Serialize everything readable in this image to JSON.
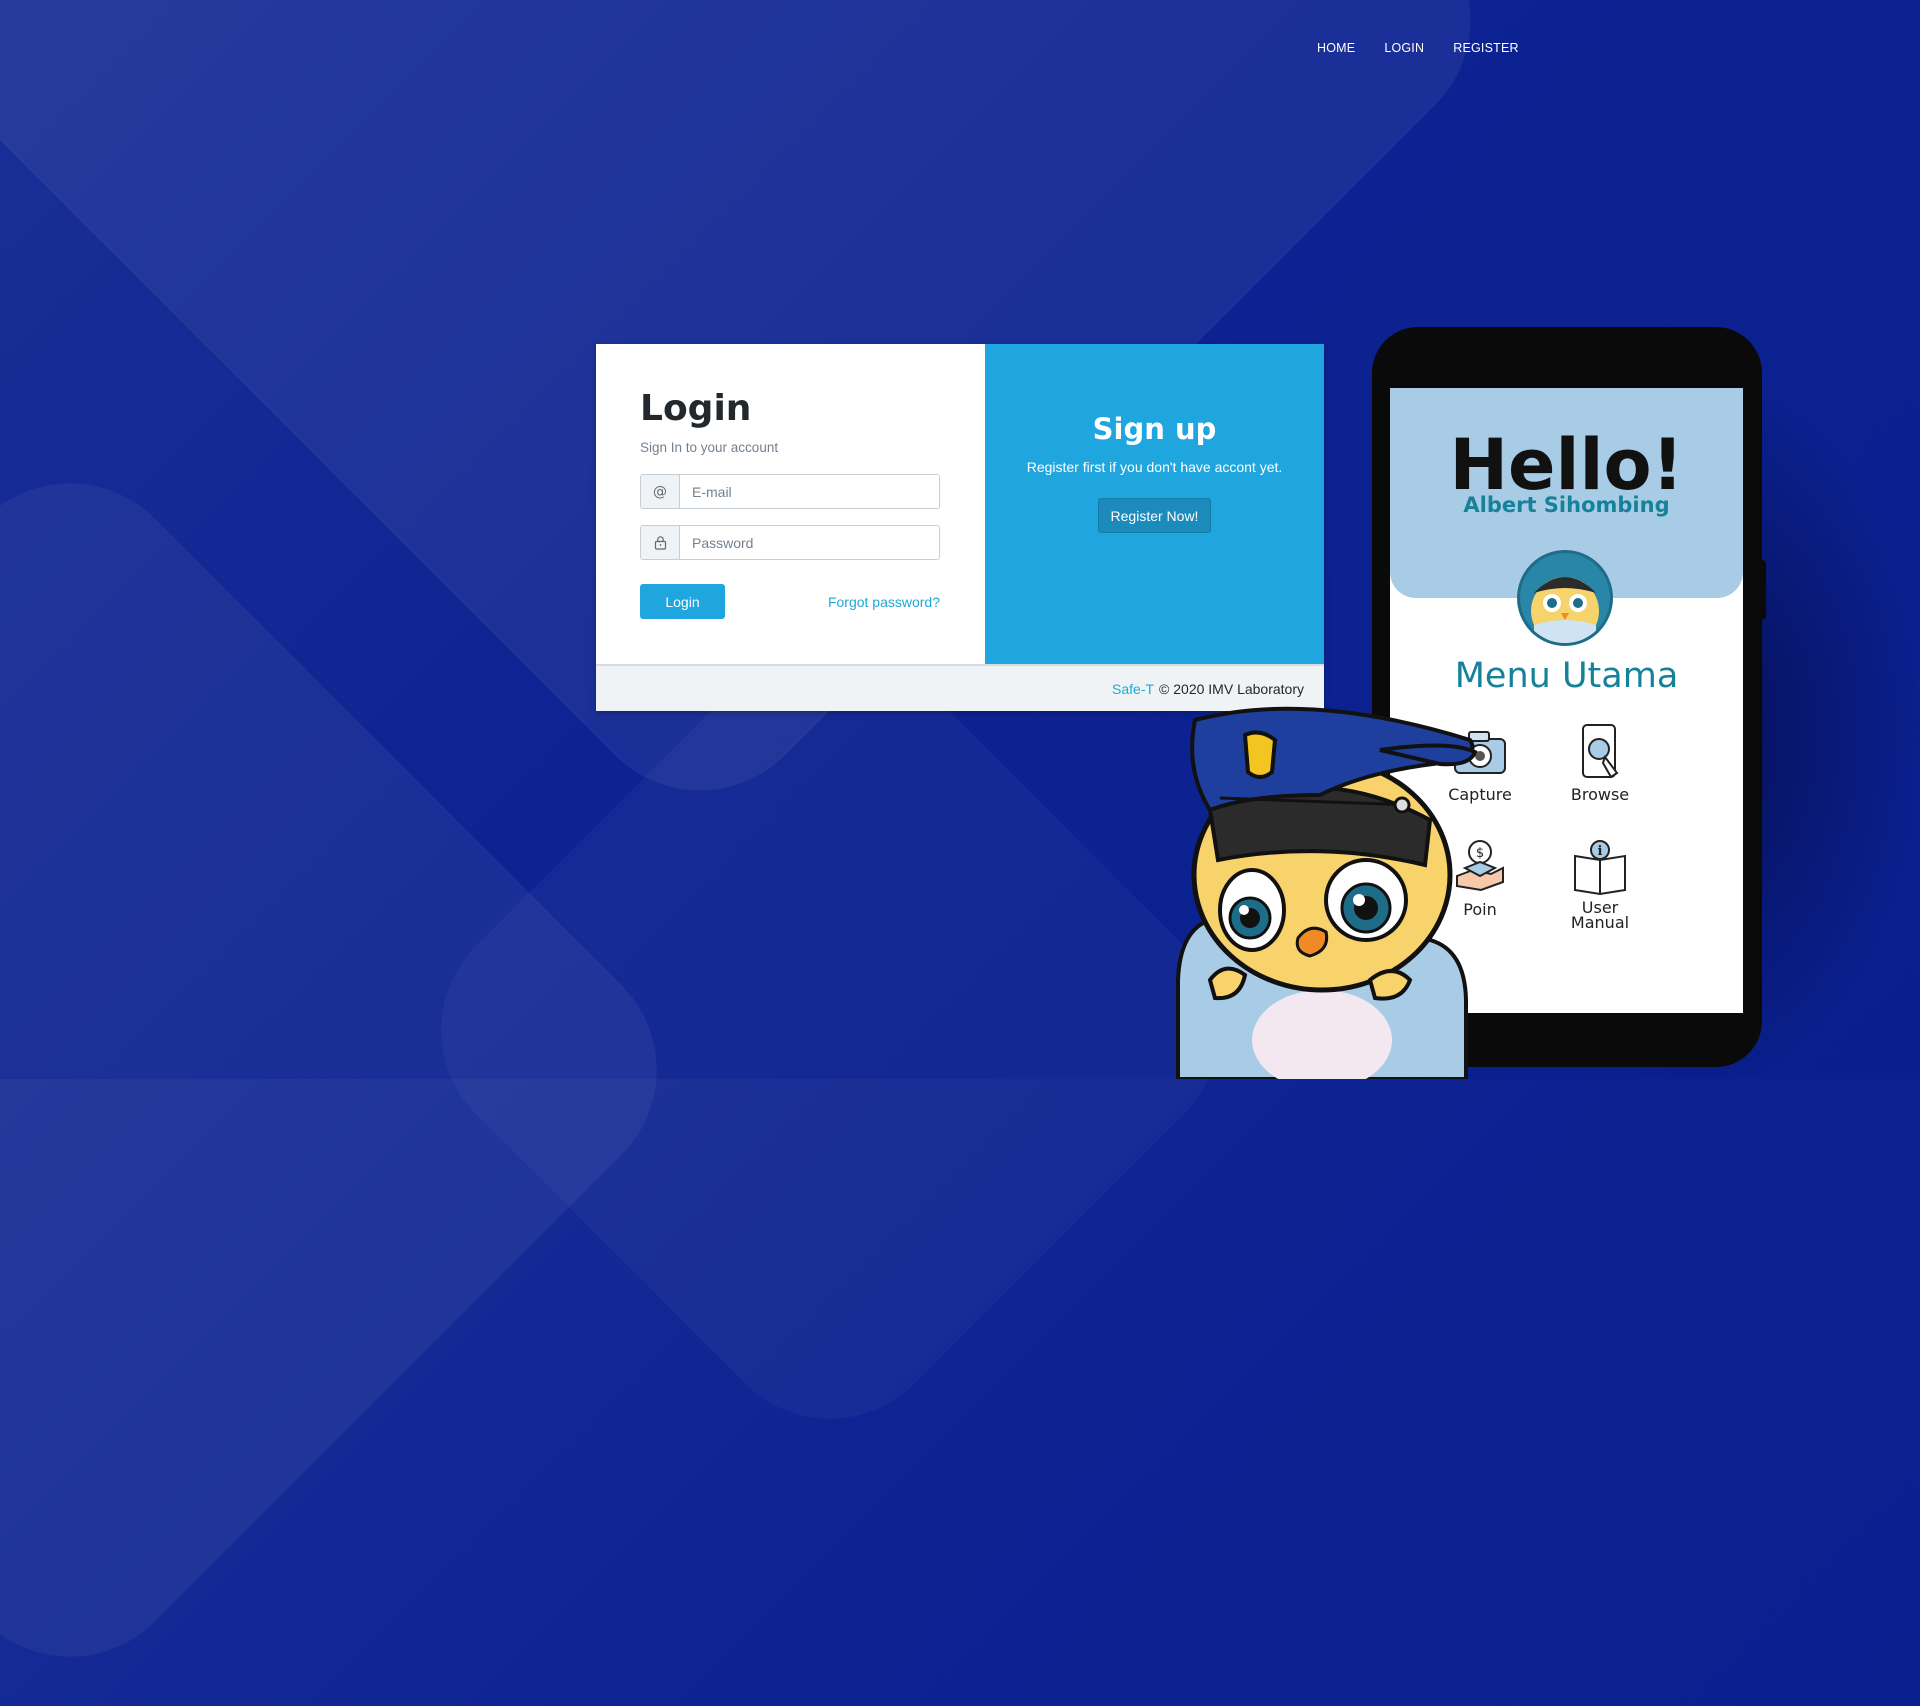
{
  "nav": {
    "home": "HOME",
    "login": "LOGIN",
    "register": "REGISTER"
  },
  "login": {
    "title": "Login",
    "subtitle": "Sign In to your account",
    "email_placeholder": "E-mail",
    "password_placeholder": "Password",
    "email_prefix": "@",
    "submit_label": "Login",
    "forgot_label": "Forgot password?"
  },
  "signup": {
    "title": "Sign up",
    "text": "Register first if you don't have accont yet.",
    "button_label": "Register Now!"
  },
  "footer": {
    "brand": "Safe-T",
    "copyright": "© 2020 IMV Laboratory"
  },
  "phone": {
    "greeting": "Hello!",
    "user_name": "Albert Sihombing",
    "menu_title": "Menu Utama",
    "menu_items": [
      {
        "label": "Capture",
        "icon": "camera-icon"
      },
      {
        "label": "Browse",
        "icon": "browse-icon"
      },
      {
        "label": "Poin",
        "icon": "coin-hand-icon"
      },
      {
        "label": "User Manual",
        "icon": "manual-book-icon"
      }
    ]
  },
  "colors": {
    "background": "#0d2392",
    "primary": "#1fa6de",
    "link": "#20a8d8",
    "footer_bg": "#f0f3f5",
    "phone_header": "#a8cbe6",
    "brand_teal": "#16829a"
  }
}
